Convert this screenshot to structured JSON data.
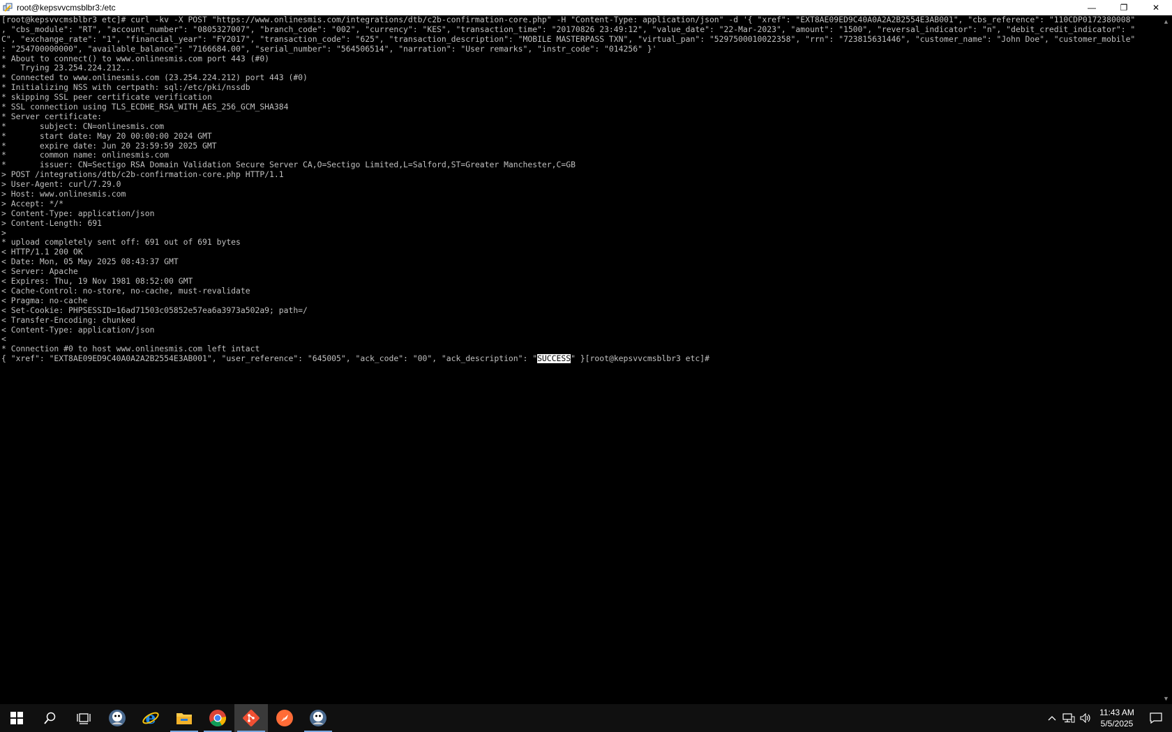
{
  "window": {
    "title": "root@kepsvvcmsblbr3:/etc",
    "controls": {
      "minimize": "—",
      "restore": "❐",
      "close": "✕"
    }
  },
  "terminal": {
    "lines": [
      "[root@kepsvvcmsblbr3 etc]# curl -kv -X POST \"https://www.onlinesmis.com/integrations/dtb/c2b-confirmation-core.php\" -H \"Content-Type: application/json\" -d '{ \"xref\": \"EXT8AE09ED9C40A0A2A2B2554E3AB001\", \"cbs_reference\": \"110CDP0172380008\"",
      ", \"cbs_module\": \"RT\", \"account_number\": \"0805327007\", \"branch_code\": \"002\", \"currency\": \"KES\", \"transaction_time\": \"20170826 23:49:12\", \"value_date\": \"22-Mar-2023\", \"amount\": \"1500\", \"reversal_indicator\": \"n\", \"debit_credit_indicator\": \"",
      "C\", \"exchange_rate\": \"1\", \"financial_year\": \"FY2017\", \"transaction_code\": \"625\", \"transaction_description\": \"MOBILE MASTERPASS TXN\", \"virtual_pan\": \"5297500010022358\", \"rrn\": \"723815631446\", \"customer_name\": \"John Doe\", \"customer_mobile\"",
      ": \"254700000000\", \"available_balance\": \"7166684.00\", \"serial_number\": \"564506514\", \"narration\": \"User remarks\", \"instr_code\": \"014256\" }'",
      "* About to connect() to www.onlinesmis.com port 443 (#0)",
      "*   Trying 23.254.224.212...",
      "* Connected to www.onlinesmis.com (23.254.224.212) port 443 (#0)",
      "* Initializing NSS with certpath: sql:/etc/pki/nssdb",
      "* skipping SSL peer certificate verification",
      "* SSL connection using TLS_ECDHE_RSA_WITH_AES_256_GCM_SHA384",
      "* Server certificate:",
      "*       subject: CN=onlinesmis.com",
      "*       start date: May 20 00:00:00 2024 GMT",
      "*       expire date: Jun 20 23:59:59 2025 GMT",
      "*       common name: onlinesmis.com",
      "*       issuer: CN=Sectigo RSA Domain Validation Secure Server CA,O=Sectigo Limited,L=Salford,ST=Greater Manchester,C=GB",
      "> POST /integrations/dtb/c2b-confirmation-core.php HTTP/1.1",
      "> User-Agent: curl/7.29.0",
      "> Host: www.onlinesmis.com",
      "> Accept: */*",
      "> Content-Type: application/json",
      "> Content-Length: 691",
      ">",
      "* upload completely sent off: 691 out of 691 bytes",
      "< HTTP/1.1 200 OK",
      "< Date: Mon, 05 May 2025 08:43:37 GMT",
      "< Server: Apache",
      "< Expires: Thu, 19 Nov 1981 08:52:00 GMT",
      "< Cache-Control: no-store, no-cache, must-revalidate",
      "< Pragma: no-cache",
      "< Set-Cookie: PHPSESSID=16ad71503c05852e57ea6a3973a502a9; path=/",
      "< Transfer-Encoding: chunked",
      "< Content-Type: application/json",
      "<",
      "* Connection #0 to host www.onlinesmis.com left intact"
    ],
    "last_line": {
      "before": "{ \"xref\": \"EXT8AE09ED9C40A0A2A2B2554E3AB001\", \"user_reference\": \"645005\", \"ack_code\": \"00\", \"ack_description\": \"",
      "selected": "SUCCESS",
      "after": "\" }[root@kepsvvcmsblbr3 etc]#"
    }
  },
  "taskbar": {
    "apps": [
      {
        "name": "start-icon"
      },
      {
        "name": "search-icon"
      },
      {
        "name": "task-view-icon"
      },
      {
        "name": "putty-icon"
      },
      {
        "name": "internet-explorer-icon"
      },
      {
        "name": "file-explorer-icon"
      },
      {
        "name": "chrome-icon"
      },
      {
        "name": "git-icon"
      },
      {
        "name": "postman-icon"
      },
      {
        "name": "putty-icon-2"
      }
    ],
    "clock": {
      "time": "11:43 AM",
      "date": "5/5/2025"
    }
  },
  "colors": {
    "terminal_bg": "#000000",
    "terminal_fg": "#c0c0c0",
    "taskbar_bg": "#101010",
    "chrome_red": "#db4437",
    "chrome_green": "#0f9d58",
    "chrome_yellow": "#f4b400",
    "ie_blue": "#1e88e5",
    "git_orange": "#f05033",
    "postman_orange": "#ff6c37",
    "folder_yellow": "#f8c94a"
  }
}
